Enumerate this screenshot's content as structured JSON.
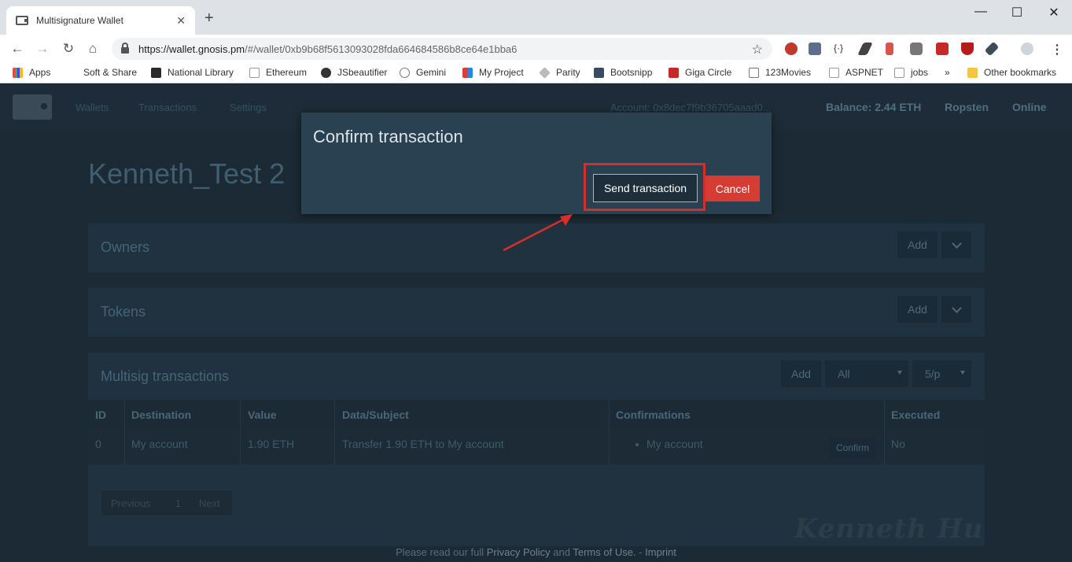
{
  "browser": {
    "tab_title": "Multisignature Wallet",
    "url_host": "https://wallet.gnosis.pm",
    "url_path": "/#/wallet/0xb9b68f5613093028fda664684586b8ce64e1bba6",
    "bookmarks": [
      {
        "label": "Apps"
      },
      {
        "label": "Soft & Share"
      },
      {
        "label": "National Library"
      },
      {
        "label": "Ethereum"
      },
      {
        "label": "JSbeautifier"
      },
      {
        "label": "Gemini"
      },
      {
        "label": "My Project"
      },
      {
        "label": "Parity"
      },
      {
        "label": "Bootsnipp"
      },
      {
        "label": "Giga Circle"
      },
      {
        "label": "123Movies"
      },
      {
        "label": "ASPNET"
      },
      {
        "label": "jobs"
      },
      {
        "label": "»"
      },
      {
        "label": "Other bookmarks"
      }
    ]
  },
  "nav": {
    "links": [
      "Wallets",
      "Transactions",
      "Settings"
    ],
    "account": "Account: 0x8dec7f9b36705aaad0...",
    "balance": "Balance: 2.44 ETH",
    "network": "Ropsten",
    "status": "Online"
  },
  "wallet": {
    "title": "Kenneth_Test 2"
  },
  "owners": {
    "title": "Owners",
    "add_label": "Add"
  },
  "tokens": {
    "title": "Tokens",
    "add_label": "Add"
  },
  "multisig": {
    "title": "Multisig transactions",
    "add_label": "Add",
    "filter_value": "All",
    "page_size_value": "5/p",
    "columns": [
      "ID",
      "Destination",
      "Value",
      "Data/Subject",
      "Confirmations",
      "Executed"
    ],
    "rows": [
      {
        "id": "0",
        "destination": "My account",
        "value": "1.90 ETH",
        "subject": "Transfer 1.90 ETH to My account",
        "confirmation": "My account",
        "confirm_label": "Confirm",
        "executed": "No"
      }
    ],
    "pager": {
      "previous": "Previous",
      "page": "1",
      "next": "Next"
    }
  },
  "modal": {
    "title": "Confirm transaction",
    "send_label": "Send transaction",
    "cancel_label": "Cancel"
  },
  "footer": {
    "prefix": "Please read our full ",
    "privacy": "Privacy Policy",
    "and": " and ",
    "terms": "Terms of Use.",
    "sep": " - ",
    "imprint": "Imprint"
  },
  "watermark": "Kenneth Hu",
  "colors": {
    "accent_red": "#d63b34",
    "highlight_red": "#d3302c",
    "modal_bg": "#2a4152"
  }
}
